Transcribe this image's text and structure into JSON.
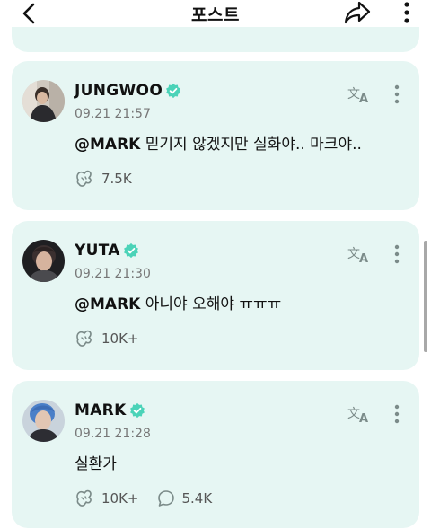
{
  "header": {
    "title": "포스트"
  },
  "posts": [
    {
      "name": "JUNGWOO",
      "time": "09.21 21:57",
      "mention": "@MARK",
      "text": " 믿기지 않겠지만 실화야.. 마크야..",
      "likes": "7.5K",
      "comments": null
    },
    {
      "name": "YUTA",
      "time": "09.21 21:30",
      "mention": "@MARK",
      "text": " 아니야 오해야 ㅠㅠㅠ",
      "likes": "10K+",
      "comments": null
    },
    {
      "name": "MARK",
      "time": "09.21 21:28",
      "mention": "",
      "text": "실환가",
      "likes": "10K+",
      "comments": "5.4K"
    }
  ],
  "colors": {
    "card_bg": "#e6f6f3",
    "verified": "#4bd3b8",
    "icon": "#7b8b89"
  },
  "icons": [
    "chevron-left-icon",
    "share-icon",
    "more-vertical-icon",
    "verified-badge-icon",
    "translate-icon",
    "like-icon",
    "comment-icon"
  ]
}
